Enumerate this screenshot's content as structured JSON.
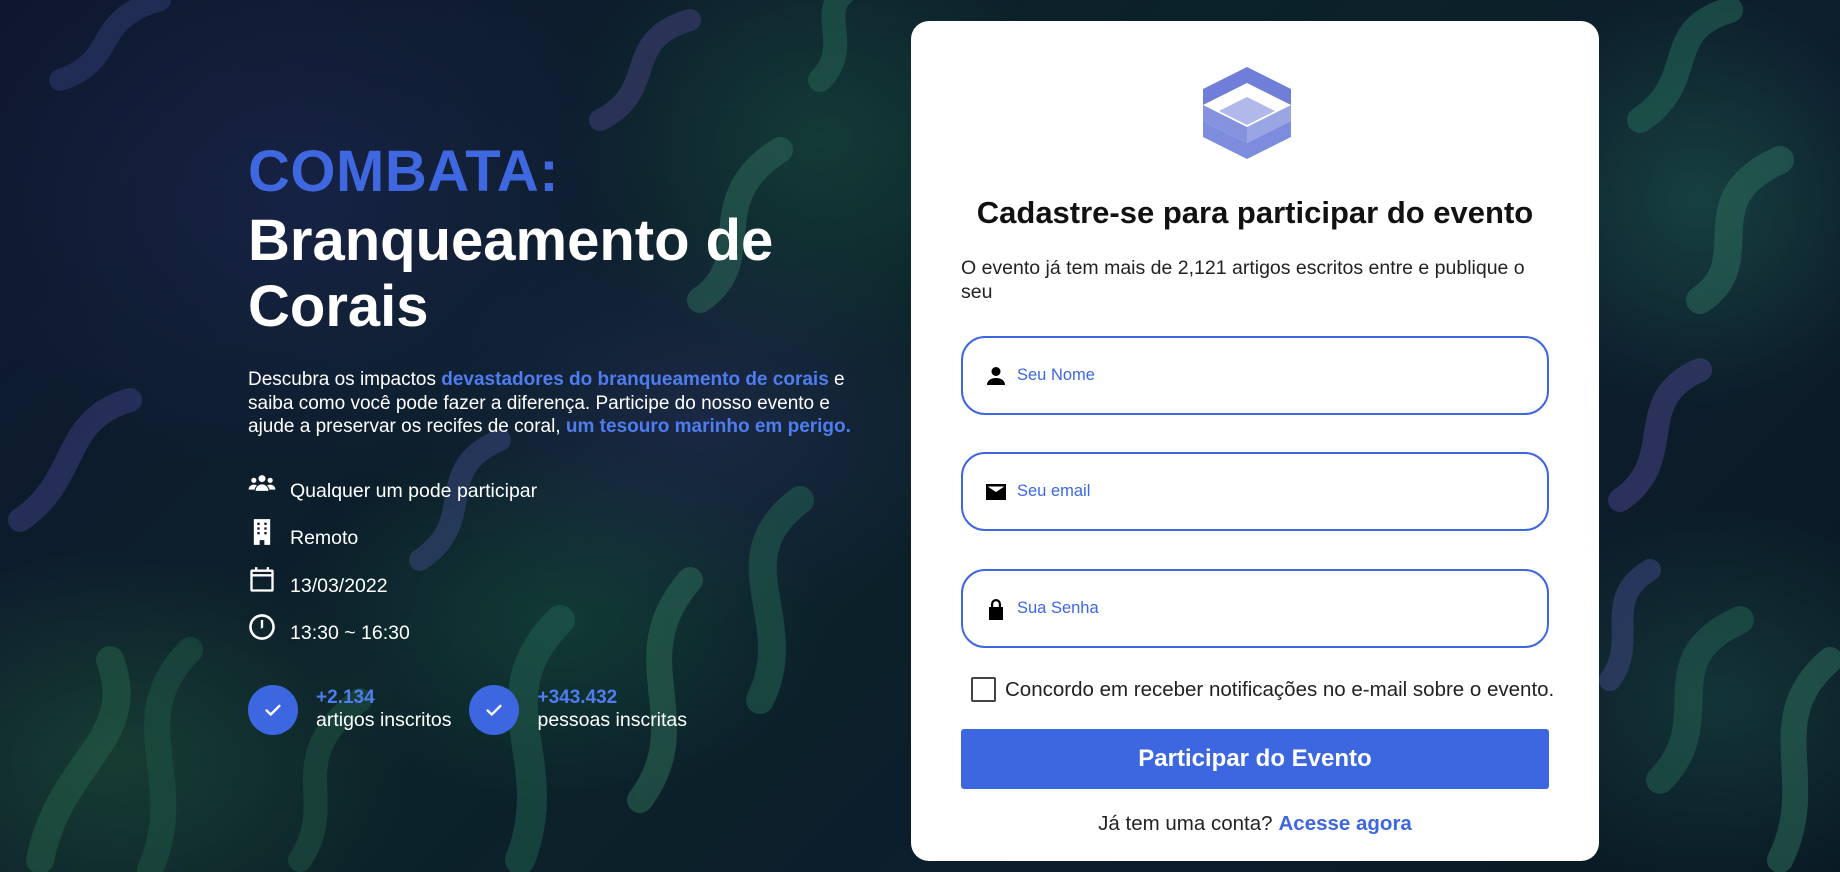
{
  "hero": {
    "kicker": "COMBATA:",
    "title_line1": "Branqueamento de",
    "title_line2": "Corais",
    "description": {
      "part1": "Descubra os impactos ",
      "highlight1": "devastadores do branqueamento de corais",
      "part2": " e saiba como você pode fazer a diferença. Participe do nosso evento e ajude a preservar os recifes de coral, ",
      "highlight2": "um tesouro marinho em perigo."
    },
    "info": [
      {
        "icon": "people-icon",
        "text": "Qualquer um pode participar"
      },
      {
        "icon": "building-icon",
        "text": "Remoto"
      },
      {
        "icon": "calendar-icon",
        "text": "13/03/2022"
      },
      {
        "icon": "clock-icon",
        "text": "13:30 ~ 16:30"
      }
    ],
    "stats": [
      {
        "value": "+2.134",
        "label": "artigos inscritos"
      },
      {
        "value": "+343.432",
        "label": "pessoas inscritas"
      }
    ]
  },
  "form": {
    "title": "Cadastre-se para participar do evento",
    "subtitle": "O evento já tem mais de 2,121 artigos escritos entre e publique o seu",
    "name_placeholder": "Seu Nome",
    "email_placeholder": "Seu email",
    "password_placeholder": "Sua Senha",
    "name_value": "",
    "email_value": "",
    "password_value": "",
    "consent_label": "Concordo em receber notificações no e-mail sobre o evento.",
    "consent_checked": false,
    "submit_label": "Participar do Evento",
    "login_prompt": "Já tem uma conta?",
    "login_link": "Acesse agora"
  },
  "colors": {
    "accent": "#3d67e0",
    "highlight_text": "#4f7df0",
    "logo": "#6f7fd9"
  }
}
